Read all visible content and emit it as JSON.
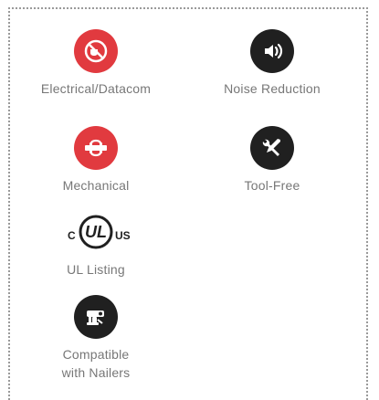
{
  "colors": {
    "red": "#e13a3f",
    "dark": "#202020",
    "label": "#777777",
    "border": "#9a9a9a"
  },
  "features": [
    {
      "label": "Electrical/Datacom",
      "icon": "plug-icon",
      "color": "red"
    },
    {
      "label": "Noise Reduction",
      "icon": "speaker-icon",
      "color": "dark"
    },
    {
      "label": "Mechanical",
      "icon": "pipe-icon",
      "color": "red"
    },
    {
      "label": "Tool-Free",
      "icon": "tools-icon",
      "color": "dark"
    },
    {
      "label": "UL Listing",
      "icon": "ul-logo",
      "color": "dark",
      "logo_text": {
        "left": "C",
        "middle": "UL",
        "right": "US"
      }
    },
    {
      "label_lines": [
        "Compatible",
        "with Nailers"
      ],
      "icon": "nailer-icon",
      "color": "dark"
    }
  ]
}
